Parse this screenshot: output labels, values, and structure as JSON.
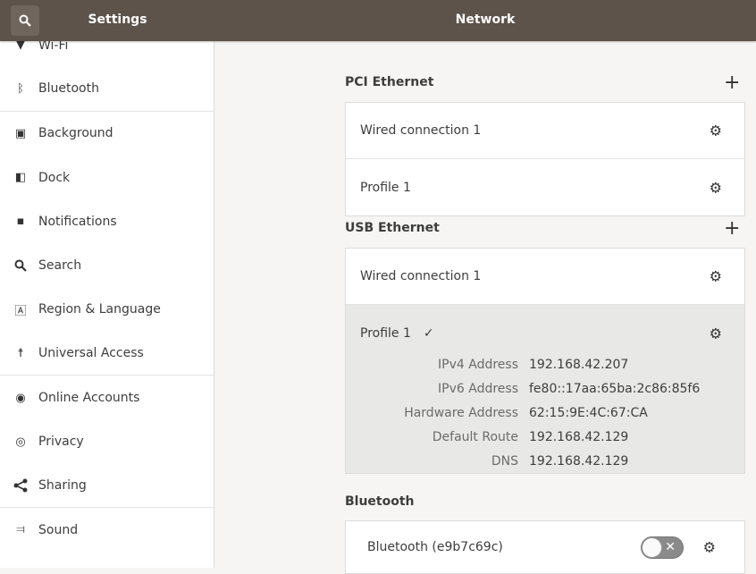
{
  "header": {
    "left_title": "Settings",
    "right_title": "Network"
  },
  "sidebar": {
    "items": [
      {
        "label": "Wi-Fi",
        "icon": "wifi-icon"
      },
      {
        "label": "Bluetooth",
        "icon": "bluetooth-icon"
      },
      {
        "label": "Background",
        "icon": "background-icon"
      },
      {
        "label": "Dock",
        "icon": "dock-icon"
      },
      {
        "label": "Notifications",
        "icon": "notifications-icon"
      },
      {
        "label": "Search",
        "icon": "search-icon"
      },
      {
        "label": "Region & Language",
        "icon": "region-icon"
      },
      {
        "label": "Universal Access",
        "icon": "accessibility-icon"
      },
      {
        "label": "Online Accounts",
        "icon": "online-accounts-icon"
      },
      {
        "label": "Privacy",
        "icon": "privacy-icon"
      },
      {
        "label": "Sharing",
        "icon": "share-icon"
      },
      {
        "label": "Sound",
        "icon": "sound-icon"
      }
    ]
  },
  "main": {
    "pci": {
      "title": "PCI Ethernet",
      "rows": [
        "Wired connection 1",
        "Profile 1"
      ]
    },
    "usb": {
      "title": "USB Ethernet",
      "wired": "Wired connection 1",
      "profile": "Profile 1",
      "details": [
        {
          "label": "IPv4 Address",
          "value": "192.168.42.207"
        },
        {
          "label": "IPv6 Address",
          "value": "fe80::17aa:65ba:2c86:85f6"
        },
        {
          "label": "Hardware Address",
          "value": "62:15:9E:4C:67:CA"
        },
        {
          "label": "Default Route",
          "value": "192.168.42.129"
        },
        {
          "label": "DNS",
          "value": "192.168.42.129"
        }
      ]
    },
    "bluetooth": {
      "title": "Bluetooth",
      "device": "Bluetooth (e9b7c69c)",
      "enabled": false
    }
  }
}
